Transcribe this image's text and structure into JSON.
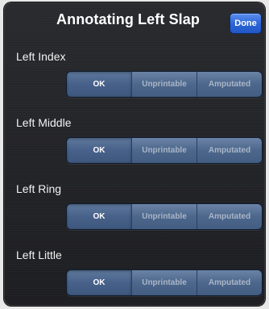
{
  "header": {
    "title": "Annotating Left Slap",
    "done_label": "Done"
  },
  "options": [
    "OK",
    "Unprintable",
    "Amputated"
  ],
  "fingers": [
    {
      "label": "Left Index",
      "selected": "OK"
    },
    {
      "label": "Left Middle",
      "selected": "OK"
    },
    {
      "label": "Left Ring",
      "selected": "OK"
    },
    {
      "label": "Left Little",
      "selected": "OK"
    }
  ],
  "colors": {
    "done_button": "#2b63d6",
    "segment": "#4d678c",
    "panel": "#232428"
  }
}
